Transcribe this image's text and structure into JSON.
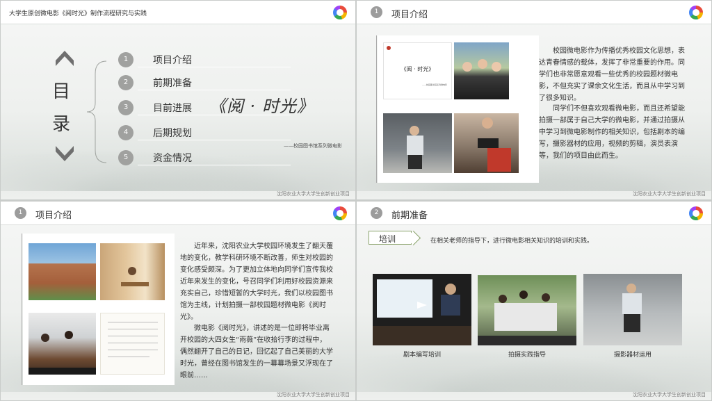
{
  "slide1": {
    "header_title": "大学生原创微电影《阅时光》制作流程研究与实践",
    "toc_char1": "目",
    "toc_char2": "录",
    "items": [
      {
        "num": "1",
        "label": "项目介绍"
      },
      {
        "num": "2",
        "label": "前期准备"
      },
      {
        "num": "3",
        "label": "目前进展"
      },
      {
        "num": "4",
        "label": "后期规划"
      },
      {
        "num": "5",
        "label": "资金情况"
      }
    ],
    "film_title": "《阅 · 时光》",
    "film_subtitle": "——校园图书馆系列微电影",
    "footer": "沈阳农业大学大学生创新创业项目"
  },
  "slide2": {
    "num": "1",
    "title": "项目介绍",
    "poster_text": "《阅 · 时光》",
    "poster_sub": "——校园图书馆系列微电影",
    "paragraphs": [
      "校园微电影作为传播优秀校园文化思想，表达青春情感的载体，发挥了非常重要的作用。同学们也非常愿意观看一些优秀的校园题材微电影，不但充实了课余文化生活，而且从中学习到了很多知识。",
      "同学们不但喜欢观看微电影，而且还希望能拍摄一部属于自己大学的微电影，并通过拍摄从中学习到微电影制作的相关知识，包括剧本的编写，摄影器材的应用，视频的剪辑，演员表演等，我们的项目由此而生。"
    ],
    "footer": "沈阳农业大学大学生创新创业项目"
  },
  "slide3": {
    "num": "1",
    "title": "项目介绍",
    "paragraphs": [
      "近年来，沈阳农业大学校园环境发生了翻天覆地的变化，教学科研环境不断改善，师生对校园的变化感受颇深。为了更加立体地向同学们宣传我校近年来发生的变化，号召同学们利用好校园资源来充实自己，珍惜短暂的大学时光，我们以校园图书馆为主线，计划拍摄一部校园题材微电影《阅时光》。",
      "微电影《阅时光》，讲述的是一位即将毕业离开校园的大四女生“雨薇”在收拾行李的过程中，偶然翻开了自己的日记，回忆起了自己美丽的大学时光，曾经在图书馆发生的一幕幕场景又浮现在了眼前……"
    ],
    "footer": "沈阳农业大学大学生创新创业项目"
  },
  "slide4": {
    "num": "2",
    "title": "前期准备",
    "tag": "培训",
    "intro": "在相关老师的指导下，进行微电影相关知识的培训和实践。",
    "captions": [
      "剧本编写培训",
      "拍摄实践指导",
      "摄影器材运用"
    ],
    "footer": "沈阳农业大学大学生创新创业项目"
  }
}
